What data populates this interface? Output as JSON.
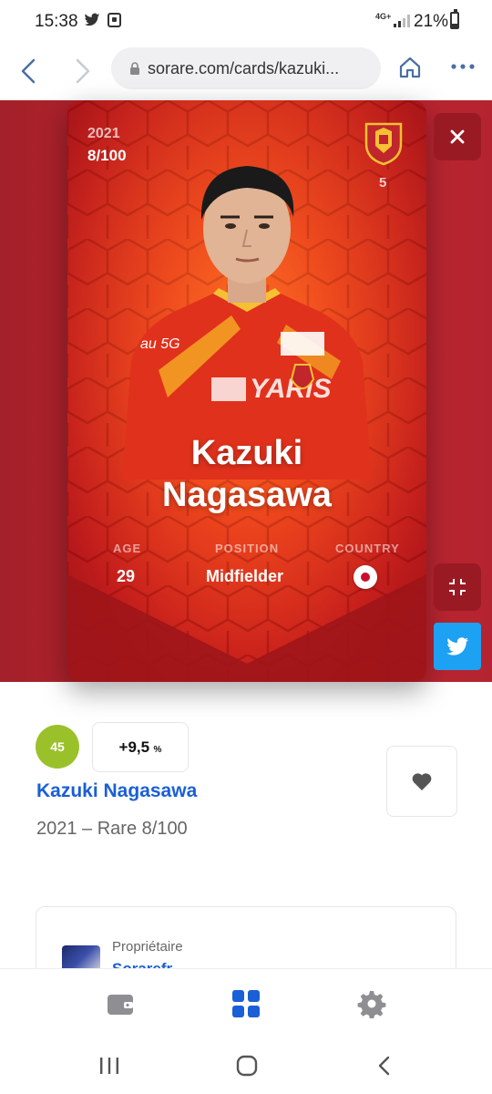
{
  "status_bar": {
    "time": "15:38",
    "network": "4G+",
    "battery": "21%"
  },
  "browser": {
    "url": "sorare.com/cards/kazuki..."
  },
  "card": {
    "year": "2021",
    "serial": "8/100",
    "rank": "5",
    "name_line1": "Kazuki",
    "name_line2": "Nagasawa",
    "age_label": "AGE",
    "age_value": "29",
    "position_label": "POSITION",
    "position_value": "Midfielder",
    "country_label": "COUNTRY",
    "colors": {
      "card_primary": "#e8321a",
      "hero_bg": "#b3232d"
    }
  },
  "info": {
    "score": "45",
    "bonus": "+9,5",
    "bonus_unit": "%",
    "player_name": "Kazuki Nagasawa",
    "subtitle": "2021 – Rare 8/100"
  },
  "owner": {
    "label": "Propriétaire",
    "name": "Sorarefr"
  },
  "icons": [
    "twitter-icon",
    "close-icon",
    "minimize-icon",
    "heart-icon",
    "wallet-icon",
    "grid-icon",
    "gear-icon"
  ],
  "accent_colors": {
    "link": "#1a5fd6",
    "score_badge": "#9bc12a",
    "twitter": "#1da1f2"
  }
}
